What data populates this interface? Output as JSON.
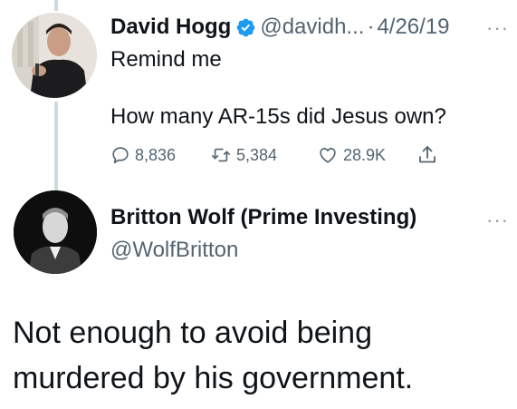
{
  "tweet1": {
    "author": {
      "name": "David Hogg",
      "verified": true,
      "handle": "@davidh...",
      "separator": "·",
      "date": "4/26/19"
    },
    "more_label": "···",
    "text_lines": [
      "Remind me",
      "How many AR-15s did Jesus own?"
    ],
    "actions": {
      "replies": "8,836",
      "retweets": "5,384",
      "likes": "28.9K"
    },
    "icons": {
      "reply": "reply-icon",
      "retweet": "retweet-icon",
      "like": "heart-icon",
      "share": "share-icon",
      "verified": "verified-badge-icon"
    }
  },
  "tweet2": {
    "author": {
      "name": "Britton Wolf (Prime Investing)",
      "handle": "@WolfBritton"
    },
    "more_label": "···",
    "text": "Not enough to avoid being murdered by his government."
  },
  "colors": {
    "text_primary": "#0f1419",
    "text_secondary": "#536471",
    "verified_blue": "#1d9bf0",
    "thread_line": "#cfd9de"
  }
}
